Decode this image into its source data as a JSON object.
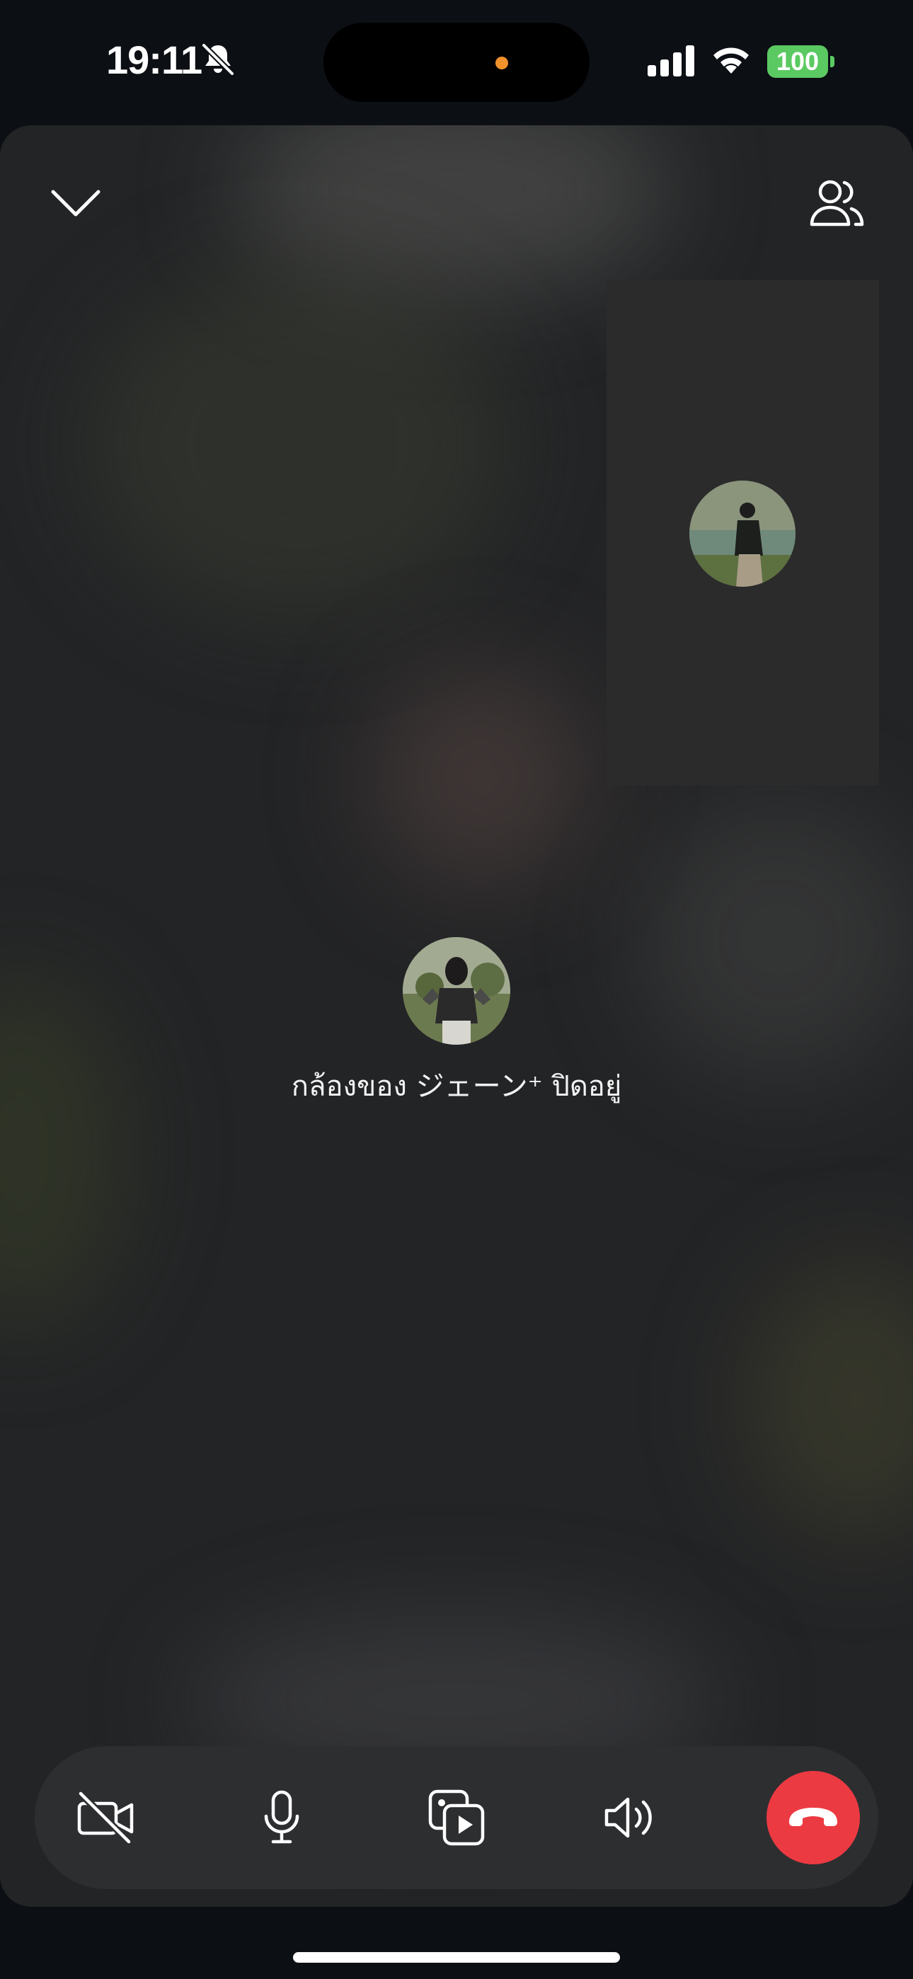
{
  "status_bar": {
    "time": "19:11",
    "battery": "100",
    "icons": [
      "bell-slash-icon",
      "signal-bars-icon",
      "wifi-icon",
      "battery-icon"
    ],
    "battery_color": "#5bc961",
    "mic_indicator_color": "#f0922c"
  },
  "call": {
    "camera_off_message": "กล้องของ ジェーン⁺ ปิดอยู่",
    "top_icons": [
      "chevron-down-icon",
      "people-icon"
    ]
  },
  "controls": {
    "icons": [
      "video-off-icon",
      "microphone-icon",
      "media-share-icon",
      "speaker-icon",
      "end-call-icon"
    ],
    "end_call_color": "#ec3a43"
  }
}
